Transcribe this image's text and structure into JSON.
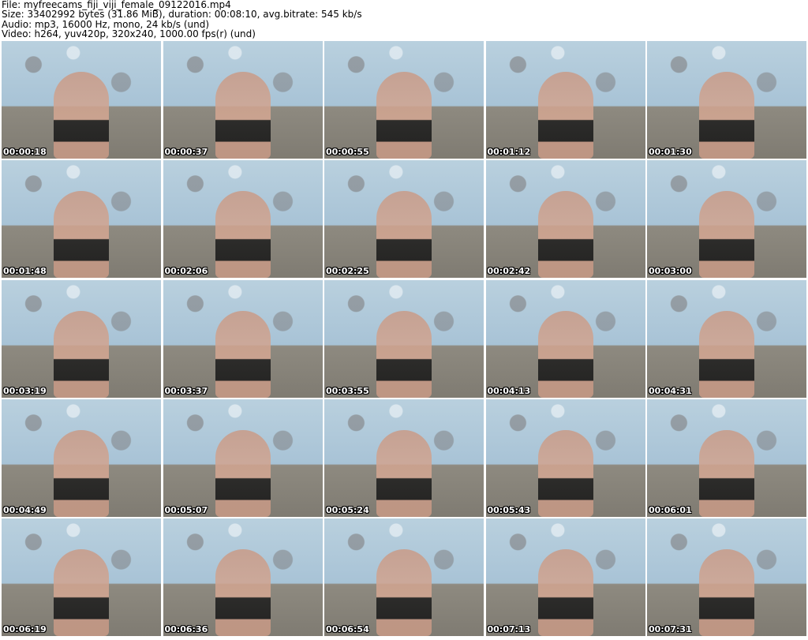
{
  "header": {
    "file": "File: myfreecams_fiji_viji_female_09122016.mp4",
    "size": "Size: 33402992 bytes (31.86 MiB), duration: 00:08:10, avg.bitrate: 545 kb/s",
    "audio": "Audio: mp3, 16000 Hz, mono, 24 kb/s (und)",
    "video": "Video: h264, yuv420p, 320x240, 1000.00 fps(r) (und)"
  },
  "thumbnails": [
    "00:00:18",
    "00:00:37",
    "00:00:55",
    "00:01:12",
    "00:01:30",
    "00:01:48",
    "00:02:06",
    "00:02:25",
    "00:02:42",
    "00:03:00",
    "00:03:19",
    "00:03:37",
    "00:03:55",
    "00:04:13",
    "00:04:31",
    "00:04:49",
    "00:05:07",
    "00:05:24",
    "00:05:43",
    "00:06:01",
    "00:06:19",
    "00:06:36",
    "00:06:54",
    "00:07:13",
    "00:07:31"
  ]
}
